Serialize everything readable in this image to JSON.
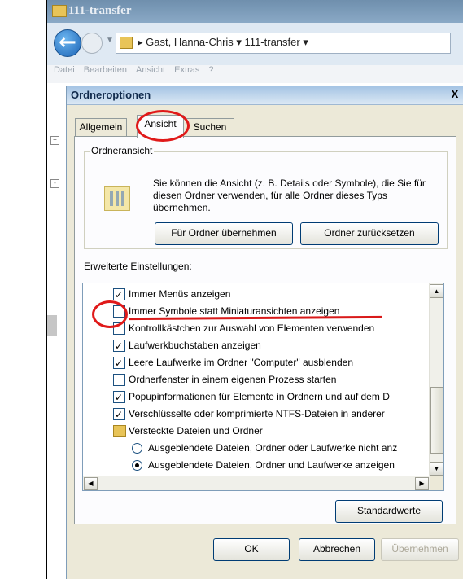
{
  "window": {
    "title": "111-transfer",
    "breadcrumb": [
      "Gast, Hanna-Chris",
      "111-transfer"
    ],
    "menu": [
      "Datei",
      "Bearbeiten",
      "Ansicht",
      "Extras",
      "?"
    ]
  },
  "dialog": {
    "title": "Ordneroptionen",
    "close_label": "X",
    "tabs": [
      {
        "label": "Allgemein"
      },
      {
        "label": "Ansicht"
      },
      {
        "label": "Suchen"
      }
    ],
    "folder_view": {
      "legend": "Ordneransicht",
      "description": "Sie können die Ansicht (z. B. Details oder Symbole), die Sie für diesen Ordner verwenden, für alle Ordner dieses Typs übernehmen.",
      "apply_button": "Für Ordner übernehmen",
      "reset_button": "Ordner zurücksetzen"
    },
    "advanced_label": "Erweiterte Einstellungen:",
    "settings": [
      {
        "type": "checkbox",
        "checked": true,
        "label": "Immer Menüs anzeigen"
      },
      {
        "type": "checkbox",
        "checked": false,
        "label": "Immer Symbole statt Miniaturansichten anzeigen"
      },
      {
        "type": "checkbox",
        "checked": false,
        "label": "Kontrollkästchen zur Auswahl von Elementen verwenden"
      },
      {
        "type": "checkbox",
        "checked": true,
        "label": "Laufwerkbuchstaben anzeigen"
      },
      {
        "type": "checkbox",
        "checked": true,
        "label": "Leere Laufwerke im Ordner \"Computer\" ausblenden"
      },
      {
        "type": "checkbox",
        "checked": false,
        "label": "Ordnerfenster in einem eigenen Prozess starten"
      },
      {
        "type": "checkbox",
        "checked": true,
        "label": "Popupinformationen für Elemente in Ordnern und auf dem D"
      },
      {
        "type": "checkbox",
        "checked": true,
        "label": "Verschlüsselte oder komprimierte NTFS-Dateien in anderer"
      },
      {
        "type": "folder",
        "label": "Versteckte Dateien und Ordner"
      },
      {
        "type": "radio",
        "checked": false,
        "label": "Ausgeblendete Dateien, Ordner oder Laufwerke nicht anz"
      },
      {
        "type": "radio",
        "checked": true,
        "label": "Ausgeblendete Dateien, Ordner und Laufwerke anzeigen"
      }
    ],
    "defaults_button": "Standardwerte",
    "ok_button": "OK",
    "cancel_button": "Abbrechen",
    "apply_button": "Übernehmen"
  },
  "icons": {
    "back": "back-arrow-icon",
    "forward": "forward-arrow-icon",
    "folder": "folder-icon",
    "folder_view": "folder-view-icon",
    "scroll_up": "scroll-up-icon",
    "scroll_down": "scroll-down-icon",
    "scroll_left": "scroll-left-icon",
    "scroll_right": "scroll-right-icon"
  },
  "colors": {
    "annotation": "#e01919",
    "dialog_bg": "#ece9d8",
    "panel_bg": "#fcfcfe"
  }
}
